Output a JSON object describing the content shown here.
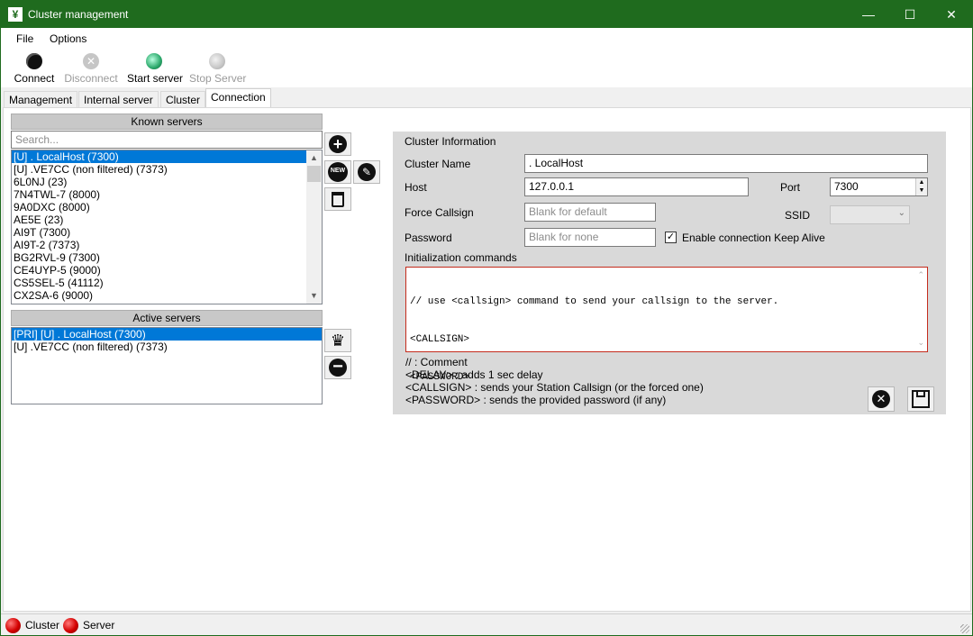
{
  "window": {
    "title": "Cluster management",
    "minimize": "—",
    "maximize": "☐",
    "close": "✕"
  },
  "menu": [
    {
      "label": "File"
    },
    {
      "label": "Options"
    }
  ],
  "toolbar": [
    {
      "label": "Connect",
      "enabled": true
    },
    {
      "label": "Disconnect",
      "enabled": false
    },
    {
      "label": "Start server",
      "enabled": true
    },
    {
      "label": "Stop Server",
      "enabled": false
    }
  ],
  "tabs": [
    {
      "label": "Management"
    },
    {
      "label": "Internal server"
    },
    {
      "label": "Cluster"
    },
    {
      "label": "Connection",
      "active": true
    }
  ],
  "known_servers": {
    "header": "Known servers",
    "search_placeholder": "Search...",
    "items": [
      "[U] . LocalHost (7300)",
      "[U] .VE7CC (non filtered) (7373)",
      "6L0NJ (23)",
      "7N4TWL-7 (8000)",
      "9A0DXC (8000)",
      "AE5E (23)",
      "AI9T (7300)",
      "AI9T-2 (7373)",
      "BG2RVL-9 (7300)",
      "CE4UYP-5 (9000)",
      "CS5SEL-5 (41112)",
      "CX2SA-6 (9000)"
    ],
    "selected_index": 0,
    "new_badge": "NEW"
  },
  "active_servers": {
    "header": "Active servers",
    "items": [
      "[PRI] [U] . LocalHost (7300)",
      "[U] .VE7CC (non filtered) (7373)"
    ],
    "selected_index": 0
  },
  "cluster_info": {
    "section_title": "Cluster Information",
    "name_label": "Cluster Name",
    "name_value": ". LocalHost",
    "host_label": "Host",
    "host_value": "127.0.0.1",
    "port_label": "Port",
    "port_value": "7300",
    "force_callsign_label": "Force Callsign",
    "force_callsign_placeholder": "Blank for default",
    "ssid_label": "SSID",
    "password_label": "Password",
    "password_placeholder": "Blank for none",
    "keepalive_label": "Enable connection Keep Alive",
    "keepalive_checked": true,
    "init_label": "Initialization commands",
    "init_lines": [
      "// use <callsign> command to send your callsign to the server.",
      "<CALLSIGN>",
      "<PASSWORD>"
    ],
    "help": [
      "// : Comment",
      "<DELAY> : adds 1 sec delay",
      "<CALLSIGN> : sends your Station Callsign (or the forced one)",
      "<PASSWORD> : sends the provided password (if any)"
    ]
  },
  "status": {
    "cluster_label": "Cluster",
    "server_label": "Server",
    "led_color": "#d40000"
  }
}
